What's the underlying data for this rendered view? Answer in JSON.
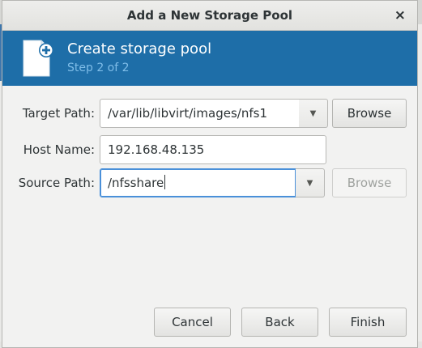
{
  "dialog": {
    "title": "Add a New Storage Pool",
    "close_glyph": "×"
  },
  "banner": {
    "icon": "new-document-icon",
    "title": "Create storage pool",
    "step": "Step 2 of 2",
    "bg_color": "#1e6ea8",
    "step_color": "#7fbde8"
  },
  "form": {
    "target_path": {
      "label": "Target Path:",
      "value": "/var/lib/libvirt/images/nfs1",
      "browse_label": "Browse"
    },
    "host_name": {
      "label": "Host Name:",
      "value": "192.168.48.135"
    },
    "source_path": {
      "label": "Source Path:",
      "value": "/nfsshare",
      "browse_label": "Browse"
    }
  },
  "footer": {
    "cancel_label": "Cancel",
    "back_label": "Back",
    "finish_label": "Finish"
  }
}
